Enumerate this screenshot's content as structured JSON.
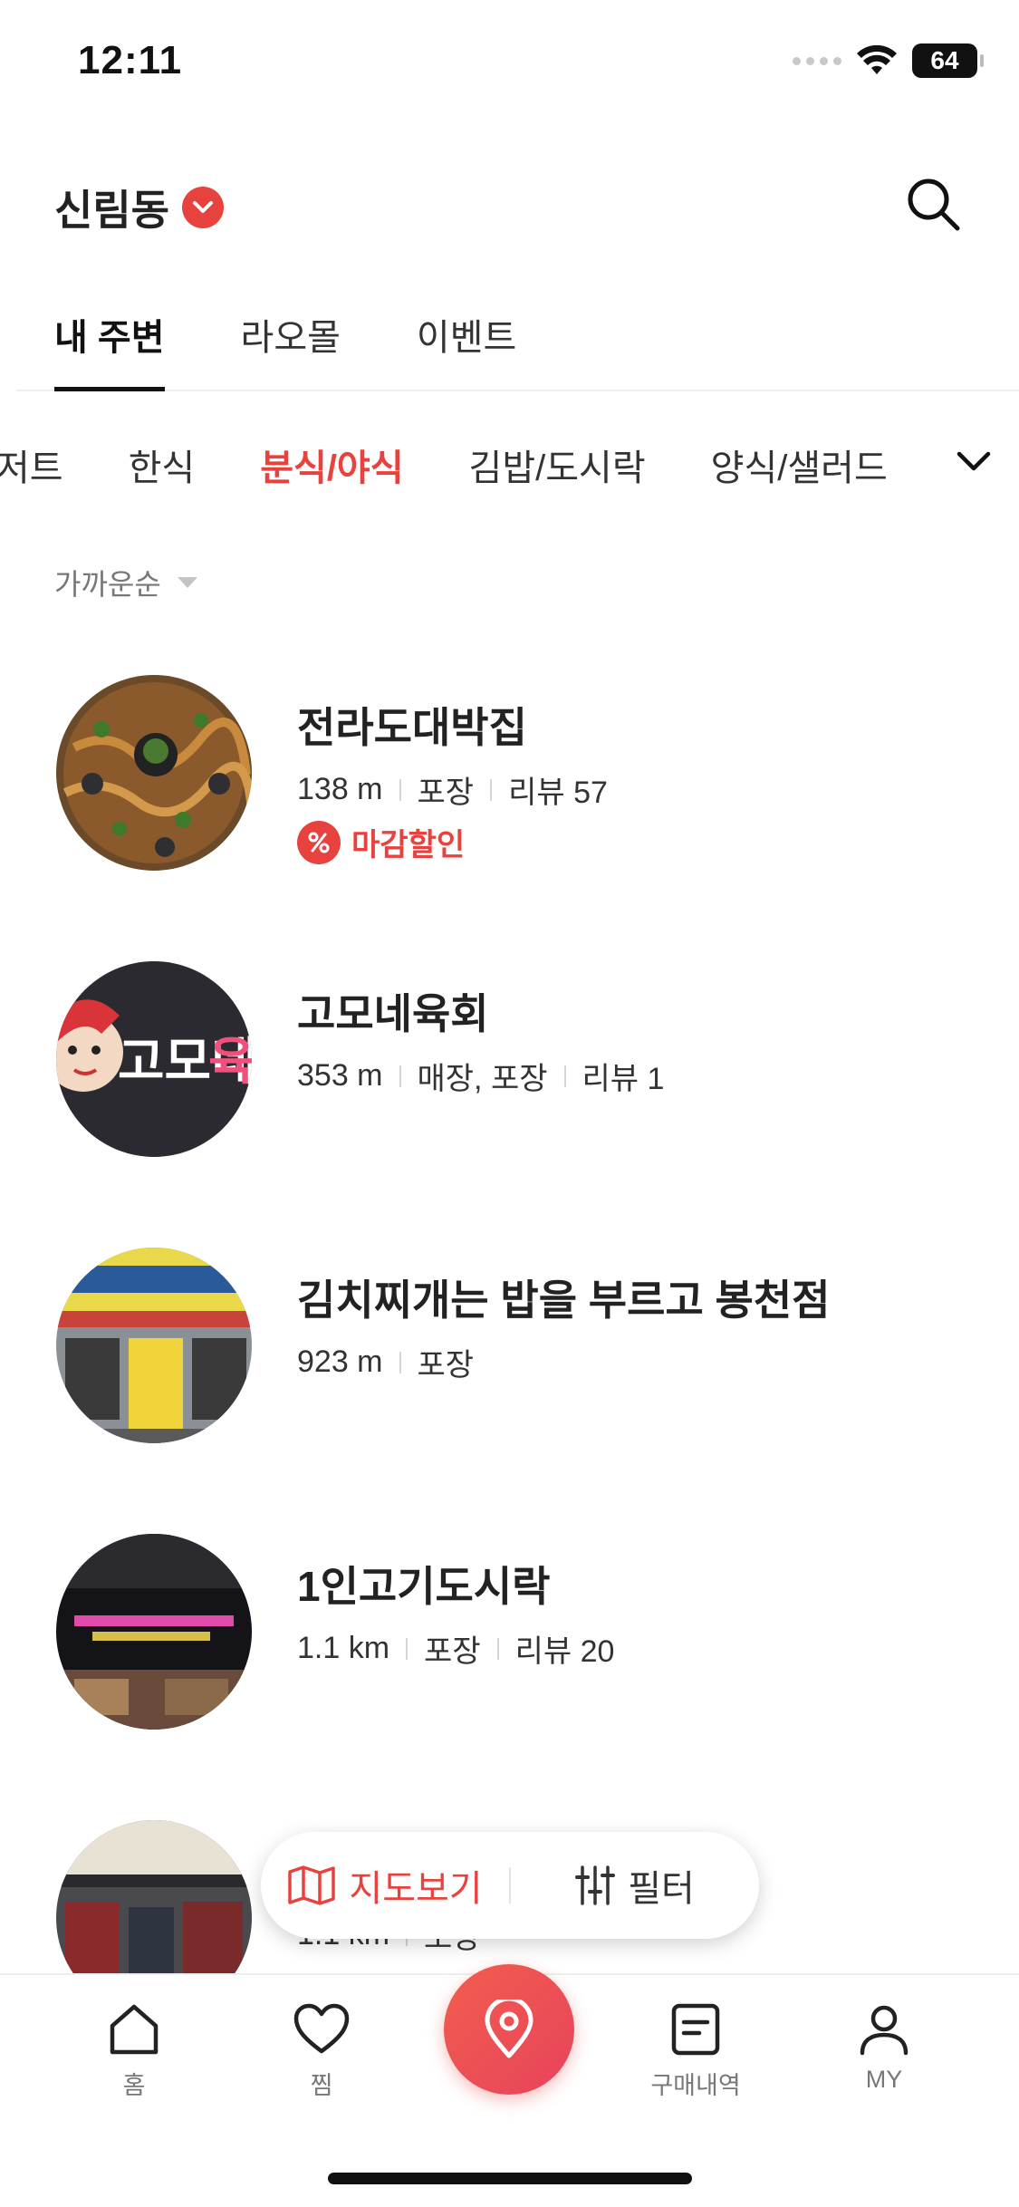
{
  "status_bar": {
    "time": "12:11",
    "battery": "64"
  },
  "header": {
    "location": "신림동"
  },
  "main_tabs": [
    {
      "label": "내 주변",
      "active": true
    },
    {
      "label": "라오몰",
      "active": false
    },
    {
      "label": "이벤트",
      "active": false
    }
  ],
  "categories": [
    {
      "label": "저트",
      "active": false
    },
    {
      "label": "한식",
      "active": false
    },
    {
      "label": "분식/야식",
      "active": true
    },
    {
      "label": "김밥/도시락",
      "active": false
    },
    {
      "label": "양식/샐러드",
      "active": false
    }
  ],
  "sort": {
    "label": "가까운순"
  },
  "stores": [
    {
      "name": "전라도대박집",
      "distance": "138 m",
      "service": "포장",
      "reviews": "리뷰 57",
      "badge": "마감할인"
    },
    {
      "name": "고모네육회",
      "distance": "353 m",
      "service": "매장, 포장",
      "reviews": "리뷰 1",
      "badge": ""
    },
    {
      "name": "김치찌개는 밥을 부르고 봉천점",
      "distance": "923 m",
      "service": "포장",
      "reviews": "",
      "badge": ""
    },
    {
      "name": "1인고기도시락",
      "distance": "1.1 km",
      "service": "포장",
      "reviews": "리뷰 20",
      "badge": ""
    },
    {
      "name": "",
      "distance": "1.1 km",
      "service": "포장",
      "reviews": "",
      "badge": ""
    }
  ],
  "float_bar": {
    "map_label": "지도보기",
    "filter_label": "필터"
  },
  "bottom_nav": {
    "home": "홈",
    "favorites": "찜",
    "orders": "구매내역",
    "my": "MY"
  },
  "colors": {
    "accent": "#e8423f",
    "text": "#222222",
    "muted": "#777777"
  }
}
